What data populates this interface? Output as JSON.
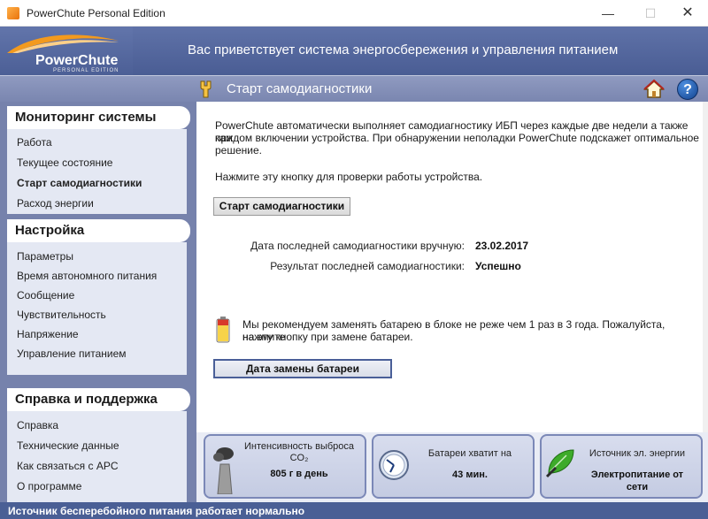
{
  "window": {
    "title": "PowerChute Personal Edition",
    "minimize": "—",
    "maximize": "☐",
    "close": "✕"
  },
  "banner": {
    "logo_text": "PowerChute",
    "logo_sub": "PERSONAL EDITION",
    "welcome": "Вас приветствует система энергосбережения и управления питанием"
  },
  "section": {
    "title": "Старт самодиагностики",
    "help": "?"
  },
  "sidebar": {
    "groups": [
      {
        "title": "Мониторинг системы",
        "items": [
          {
            "label": "Работа"
          },
          {
            "label": "Текущее состояние"
          },
          {
            "label": "Старт самодиагностики",
            "active": true
          },
          {
            "label": "Расход энергии"
          }
        ]
      },
      {
        "title": "Настройка",
        "items": [
          {
            "label": "Параметры"
          },
          {
            "label": "Время автономного питания"
          },
          {
            "label": "Сообщение"
          },
          {
            "label": "Чувствительность"
          },
          {
            "label": "Напряжение"
          },
          {
            "label": "Управление питанием"
          }
        ]
      },
      {
        "title": "Справка и поддержка",
        "items": [
          {
            "label": "Справка"
          },
          {
            "label": "Технические данные"
          },
          {
            "label": "Как связаться с APC"
          },
          {
            "label": "О программе"
          }
        ]
      }
    ]
  },
  "main": {
    "intro_line1": "PowerChute автоматически выполняет самодиагностику ИБП через каждые две недели а также при",
    "intro_line2": "каждом включении устройства. При обнаружении неполадки PowerChute подскажет оптимальное",
    "intro_line3": "решение.",
    "prompt": "Нажмите эту кнопку для проверки работы устройства.",
    "start_button": "Старт самодиагностики",
    "last_manual_label": "Дата последней самодиагностики вручную:",
    "last_manual_value": "23.02.2017",
    "last_result_label": "Результат последней самодиагностики:",
    "last_result_value": "Успешно",
    "battery_note_line1": "Мы рекомендуем заменять батарею в блоке не реже чем 1 раз в 3 года. Пожалуйста, нажмите",
    "battery_note_line2": "на эту кнопку при замене батареи.",
    "battery_button": "Дата замены батареи"
  },
  "panels": {
    "co2_label_line1": "Интенсивность выброса",
    "co2_label_line2": "CO₂",
    "co2_value": "805 г в день",
    "runtime_label": "Батареи хватит на",
    "runtime_value": "43 мин.",
    "source_label": "Источник эл. энергии",
    "source_value_line1": "Электропитание от",
    "source_value_line2": "сети"
  },
  "status": {
    "text": "Источник бесперебойного питания работает нормально"
  },
  "colors": {
    "banner": "#4a5d94",
    "sidebar": "#7682ac",
    "statusbar": "#4a5f95",
    "panel_border": "#7b88b7"
  }
}
